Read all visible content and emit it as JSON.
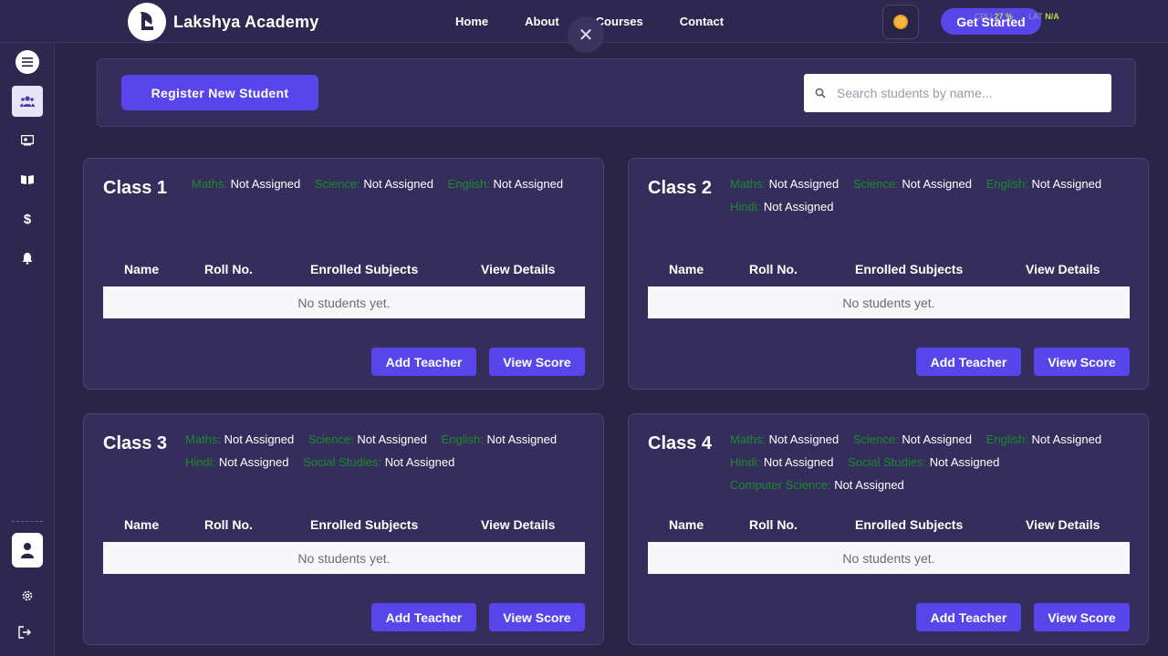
{
  "brand": {
    "name": "Lakshya Academy"
  },
  "nav": {
    "links": [
      "Home",
      "About",
      "Courses",
      "Contact"
    ],
    "get_started": "Get Started",
    "close": "✕"
  },
  "system_stats": [
    {
      "label": "CPU",
      "value": "27 %"
    },
    {
      "label": "LAT",
      "value": "N/A"
    }
  ],
  "sidebar": {
    "items": [
      "menu-icon",
      "students-icon",
      "classes-icon",
      "courses-icon",
      "fees-icon",
      "notifications-icon"
    ],
    "bottom": [
      "profile-icon",
      "settings-icon",
      "logout-icon"
    ]
  },
  "toolbar": {
    "register_label": "Register New Student",
    "search_placeholder": "Search students by name..."
  },
  "table_headers": [
    "Name",
    "Roll No.",
    "Enrolled Subjects",
    "View Details"
  ],
  "empty_text": "No students yet.",
  "buttons": {
    "add_teacher": "Add Teacher",
    "view_score": "View Score"
  },
  "classes": [
    {
      "title": "Class 1",
      "subjects": [
        {
          "name": "Maths:",
          "teacher": "Not Assigned"
        },
        {
          "name": "Science:",
          "teacher": "Not Assigned"
        },
        {
          "name": "English:",
          "teacher": "Not Assigned"
        }
      ]
    },
    {
      "title": "Class 2",
      "subjects": [
        {
          "name": "Maths:",
          "teacher": "Not Assigned"
        },
        {
          "name": "Science:",
          "teacher": "Not Assigned"
        },
        {
          "name": "English:",
          "teacher": "Not Assigned"
        },
        {
          "name": "Hindi:",
          "teacher": "Not Assigned"
        }
      ]
    },
    {
      "title": "Class 3",
      "subjects": [
        {
          "name": "Maths:",
          "teacher": "Not Assigned"
        },
        {
          "name": "Science:",
          "teacher": "Not Assigned"
        },
        {
          "name": "English:",
          "teacher": "Not Assigned"
        },
        {
          "name": "Hindi:",
          "teacher": "Not Assigned"
        },
        {
          "name": "Social Studies:",
          "teacher": "Not Assigned"
        }
      ]
    },
    {
      "title": "Class 4",
      "subjects": [
        {
          "name": "Maths:",
          "teacher": "Not Assigned"
        },
        {
          "name": "Science:",
          "teacher": "Not Assigned"
        },
        {
          "name": "English:",
          "teacher": "Not Assigned"
        },
        {
          "name": "Hindi:",
          "teacher": "Not Assigned"
        },
        {
          "name": "Social Studies:",
          "teacher": "Not Assigned"
        },
        {
          "name": "Computer Science:",
          "teacher": "Not Assigned"
        }
      ]
    }
  ],
  "colors": {
    "accent": "#5846ea",
    "background": "#2a2446",
    "card": "#352e5c",
    "subject_label": "#1a8a2a"
  }
}
